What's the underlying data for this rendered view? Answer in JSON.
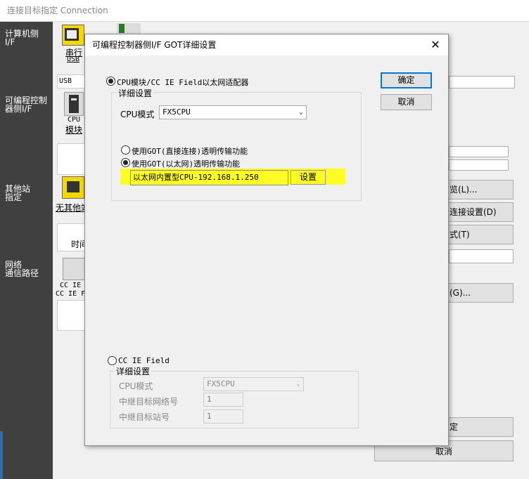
{
  "background": {
    "window_title": "连接目标指定 Connection",
    "left_labels": {
      "pc_if": [
        "计算机侧",
        "I/F"
      ],
      "plc_if": [
        "可编程控制",
        "器侧I/F"
      ],
      "other_station": [
        "其他站",
        "指定"
      ],
      "network_route": [
        "网络",
        "通信路径"
      ]
    },
    "icons": {
      "serial_usb": [
        "串行",
        "USB"
      ],
      "usb_label": "USB",
      "cpu_module": [
        "CPU",
        "模块"
      ],
      "no_other_station": "无其他站",
      "time_label": "时间",
      "cc_ie": [
        "CC IE",
        "CC IE F"
      ]
    },
    "right_buttons": {
      "browse": "览(L)...",
      "direct_connect": "连接设置(D)",
      "test": "式(T)",
      "g_button": "(G)...",
      "ok_partial": "定",
      "cancel": "取消"
    }
  },
  "dialog": {
    "title": "可编程控制器侧I/F GOT详细设置",
    "ok_label": "确定",
    "cancel_label": "取消",
    "option1": {
      "label": "CPU模块/CC IE Field以太网适配器",
      "checked": true,
      "group_title": "详细设置",
      "cpu_mode_label": "CPU模式",
      "cpu_mode_value": "FX5CPU",
      "sub_option_a": {
        "label": "使用GOT(直接连接)透明传输功能",
        "checked": false
      },
      "sub_option_b": {
        "label": "使用GOT(以太网)透明传输功能",
        "checked": true
      },
      "ethernet_value": "以太网内置型CPU-192.168.1.250",
      "setting_button": "设置"
    },
    "option2": {
      "label": "CC IE Field",
      "checked": false,
      "group_title": "详细设置",
      "cpu_mode_label": "CPU模式",
      "cpu_mode_value": "FX5CPU",
      "relay_network_label": "中继目标网络号",
      "relay_network_value": "1",
      "relay_station_label": "中继目标站号",
      "relay_station_value": "1"
    }
  },
  "colors": {
    "highlight": "#ffff00",
    "left_strip": "#404040",
    "accent": "#0078d7"
  }
}
